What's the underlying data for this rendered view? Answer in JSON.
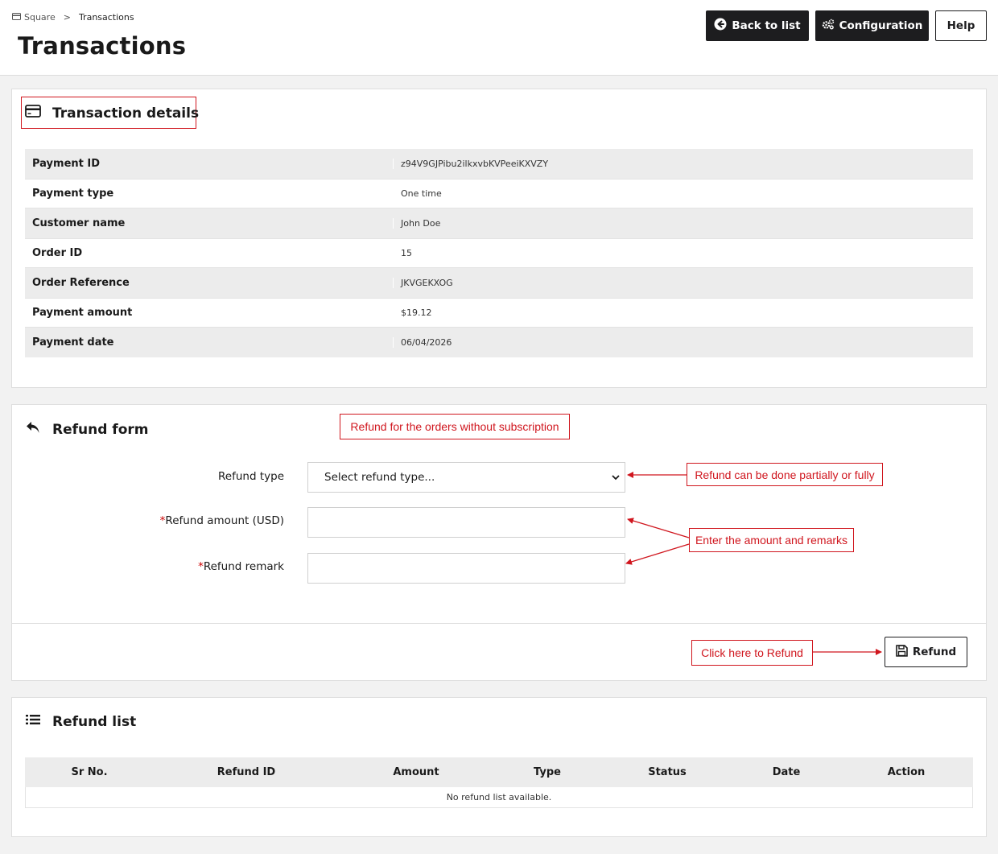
{
  "breadcrumb": {
    "root": "Square",
    "separator": ">",
    "current": "Transactions"
  },
  "header": {
    "title": "Transactions",
    "buttons": {
      "back": "Back to list",
      "config": "Configuration",
      "help": "Help"
    }
  },
  "details": {
    "title": "Transaction details",
    "rows": [
      {
        "label": "Payment ID",
        "value": "z94V9GJPibu2ilkxvbKVPeeiKXVZY"
      },
      {
        "label": "Payment type",
        "value": "One time"
      },
      {
        "label": "Customer name",
        "value": "John Doe"
      },
      {
        "label": "Order ID",
        "value": "15"
      },
      {
        "label": "Order Reference",
        "value": "JKVGEKXOG"
      },
      {
        "label": "Payment amount",
        "value": "$19.12"
      },
      {
        "label": "Payment date",
        "value": "06/04/2026"
      }
    ]
  },
  "refund_form": {
    "title": "Refund form",
    "refund_type_label": "Refund type",
    "refund_type_value": "Select refund type...",
    "amount_label": "Refund amount (USD)",
    "remark_label": "Refund remark",
    "required_mark": "*",
    "submit": "Refund"
  },
  "refund_list": {
    "title": "Refund list",
    "columns": [
      "Sr No.",
      "Refund ID",
      "Amount",
      "Type",
      "Status",
      "Date",
      "Action"
    ],
    "empty": "No refund list available."
  },
  "annotations": {
    "without_subscription": "Refund for the orders without subscription",
    "partial_full": "Refund can be done partially or fully",
    "amount_remarks": "Enter the amount and remarks",
    "click_refund": "Click here to Refund"
  },
  "colors": {
    "annotation": "#d0161e",
    "dark_button": "#1d1d1f",
    "row_alt": "#ececec"
  }
}
